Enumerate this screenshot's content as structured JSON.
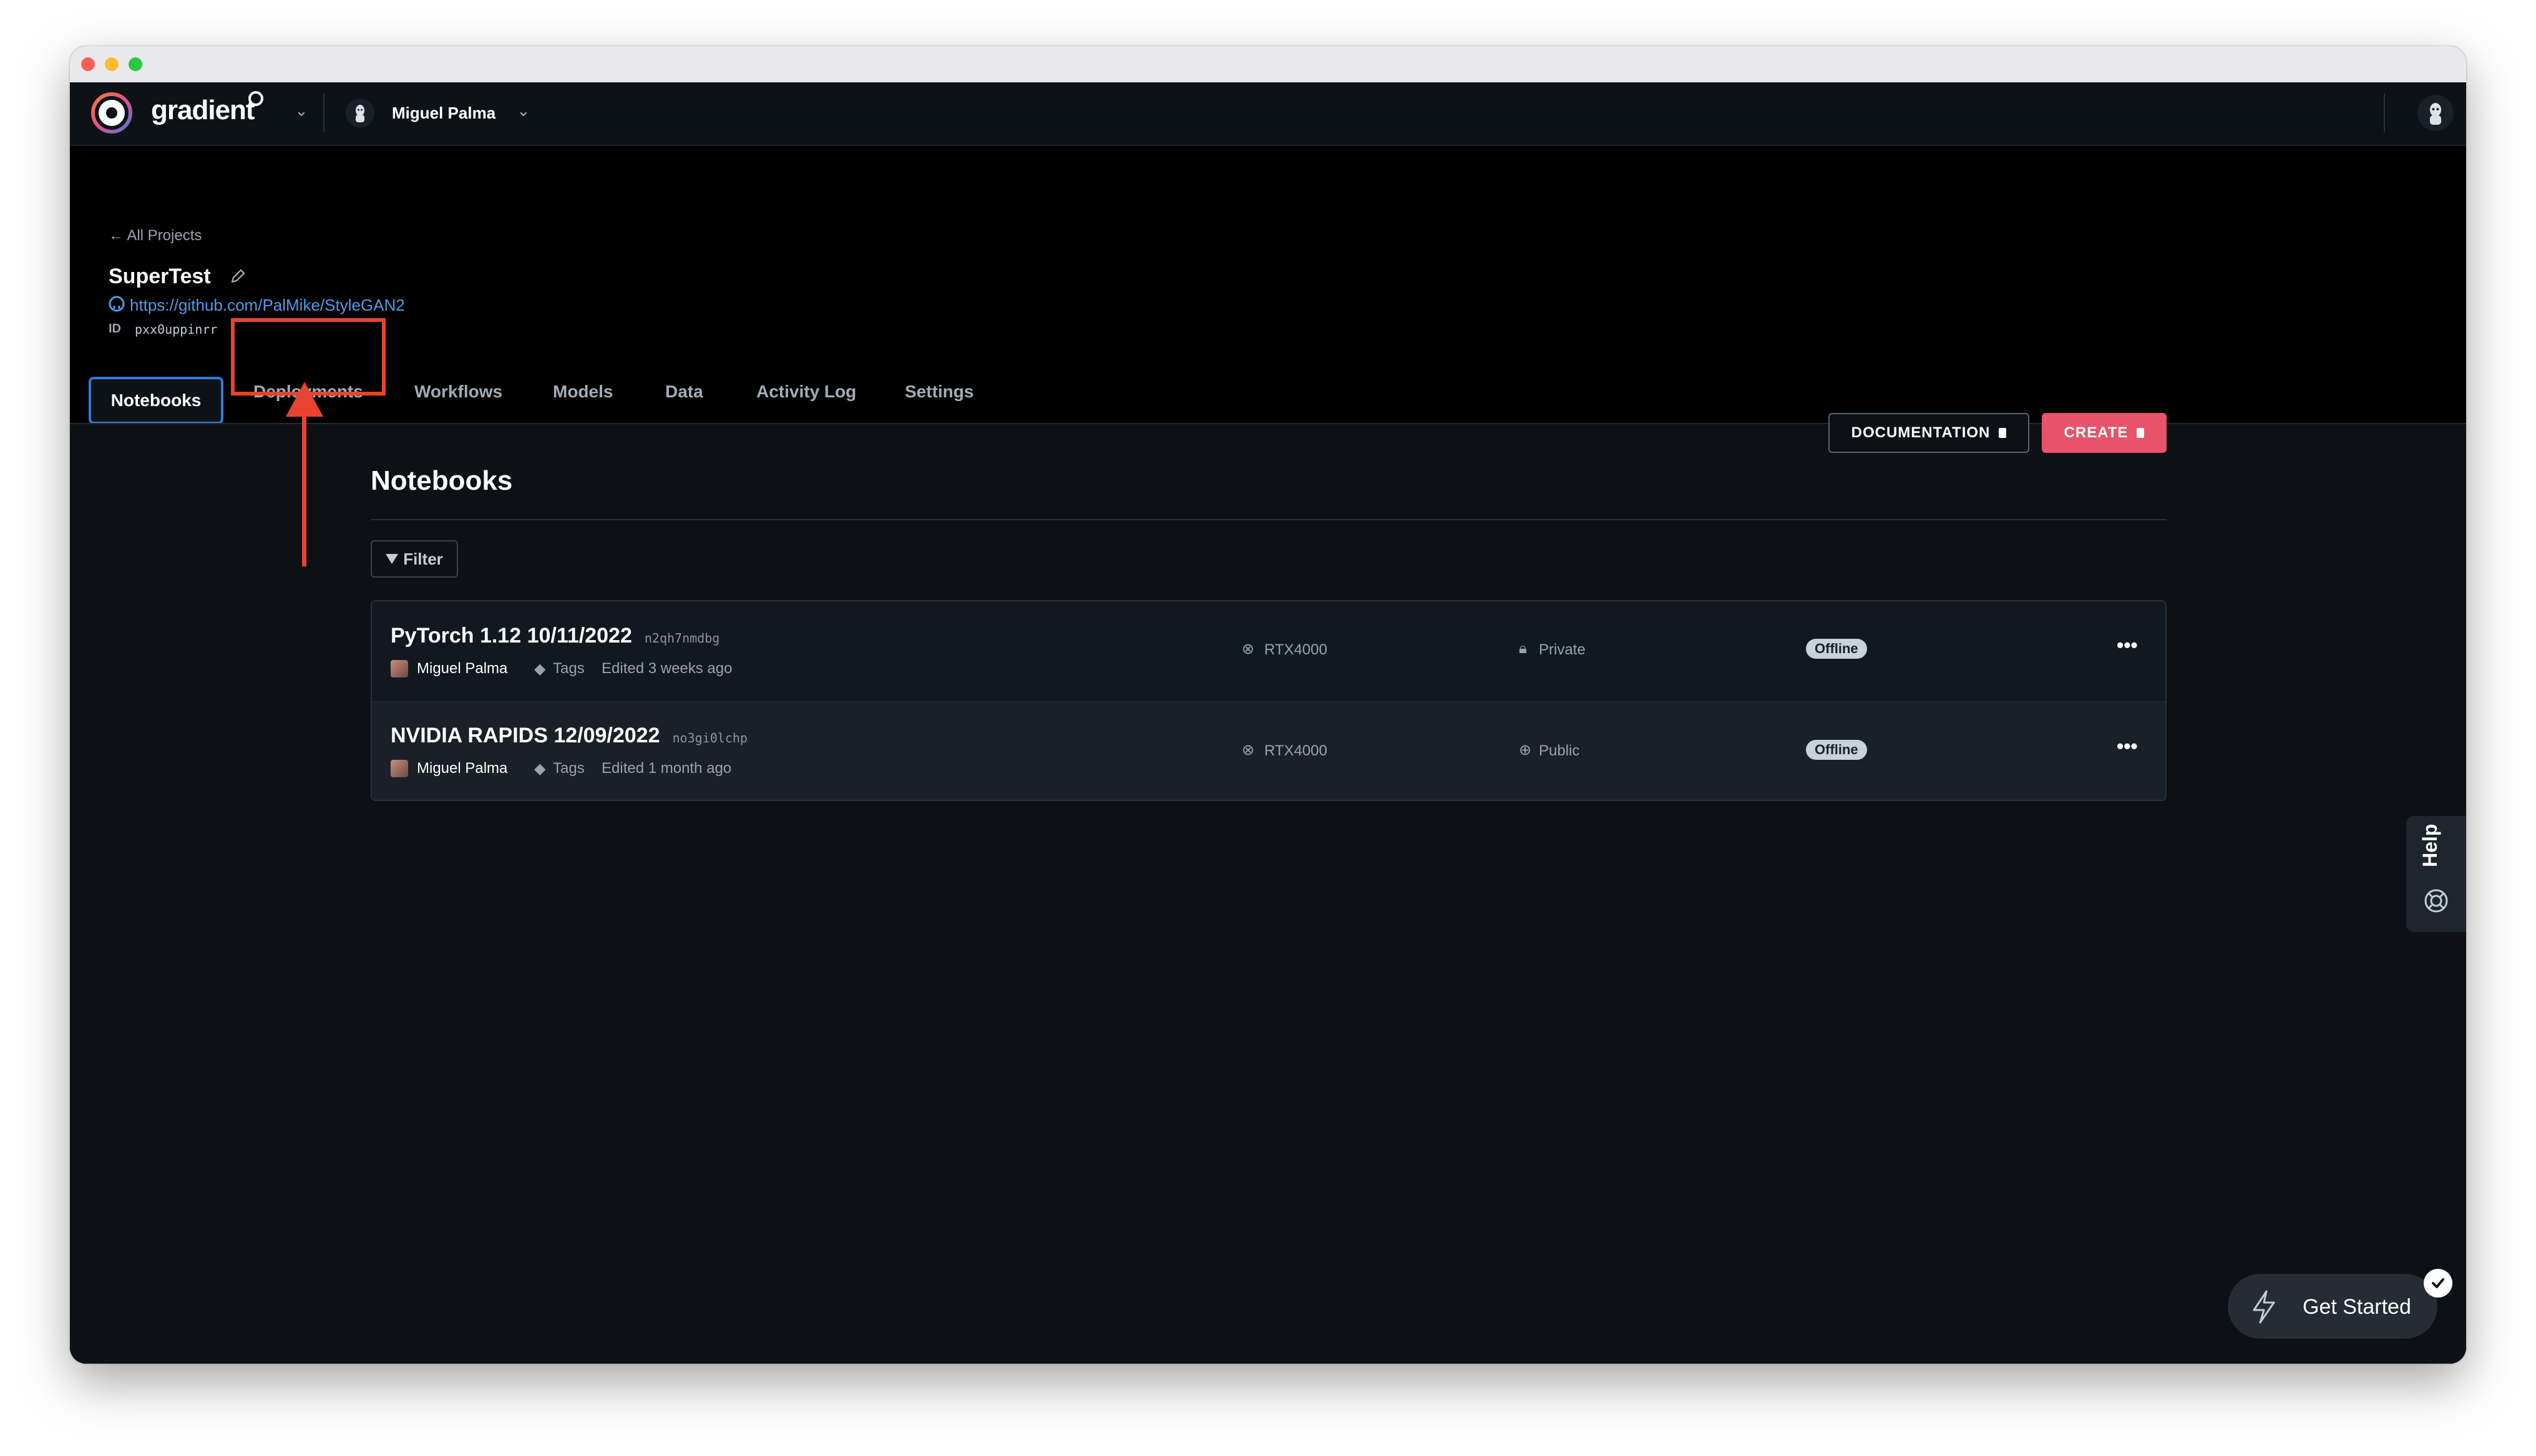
{
  "app": {
    "brand": "gradient",
    "user": "Miguel Palma"
  },
  "project": {
    "back_link": "All Projects",
    "name": "SuperTest",
    "github_url": "https://github.com/PalMike/StyleGAN2",
    "id_label": "ID",
    "id_value": "pxx0uppinrr"
  },
  "tabs": [
    "Notebooks",
    "Deployments",
    "Workflows",
    "Models",
    "Data",
    "Activity Log",
    "Settings"
  ],
  "active_tab": "Notebooks",
  "page": {
    "title": "Notebooks",
    "documentation_label": "DOCUMENTATION",
    "create_label": "CREATE",
    "filter_label": "Filter"
  },
  "notebooks": [
    {
      "title": "PyTorch 1.12 10/11/2022",
      "id": "n2qh7nmdbg",
      "owner": "Miguel Palma",
      "tags": "Tags",
      "edited": "Edited 3 weeks ago",
      "machine": "RTX4000",
      "visibility": "Private",
      "status": "Offline"
    },
    {
      "title": "NVIDIA RAPIDS 12/09/2022",
      "id": "no3gi0lchp",
      "owner": "Miguel Palma",
      "tags": "Tags",
      "edited": "Edited 1 month ago",
      "machine": "RTX4000",
      "visibility": "Public",
      "status": "Offline"
    }
  ],
  "help_label": "Help",
  "get_started_label": "Get Started",
  "colors": {
    "accent": "#2e7bd6",
    "create": "#e8526a",
    "annotation": "#e8432e",
    "background": "#0d1116"
  }
}
